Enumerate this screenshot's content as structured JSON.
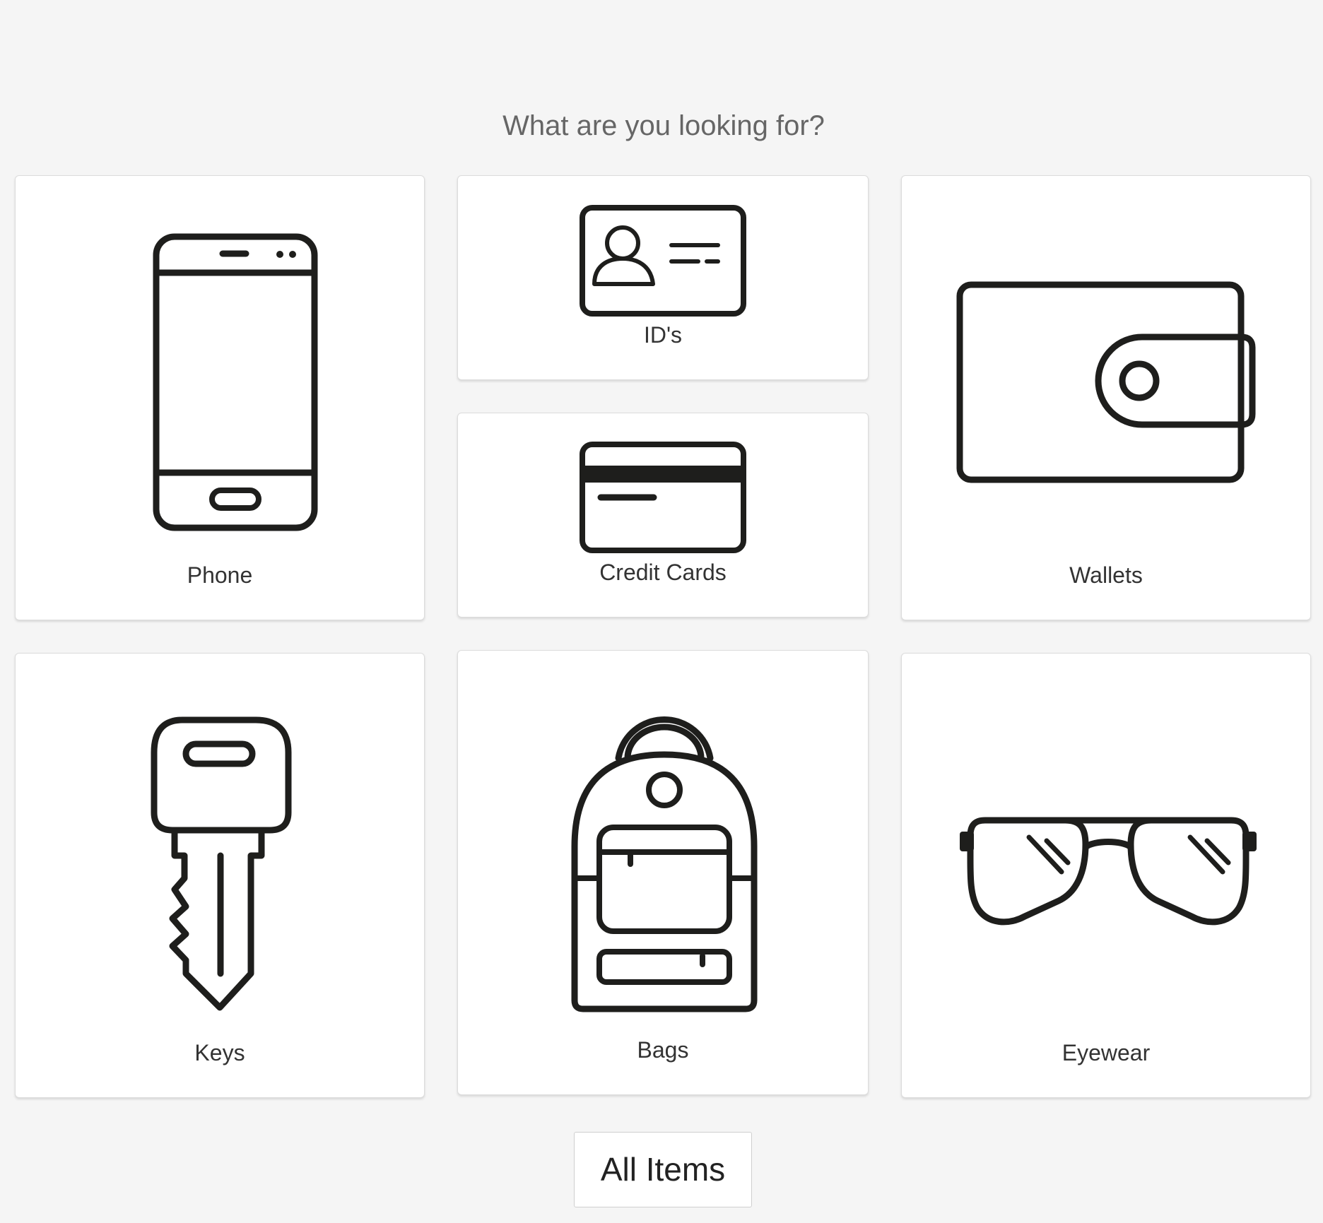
{
  "heading": "What are you looking for?",
  "categories": {
    "phone": {
      "label": "Phone",
      "icon": "phone-icon"
    },
    "ids": {
      "label": "ID's",
      "icon": "id-card-icon"
    },
    "credit_cards": {
      "label": "Credit Cards",
      "icon": "credit-card-icon"
    },
    "wallets": {
      "label": "Wallets",
      "icon": "wallet-icon"
    },
    "keys": {
      "label": "Keys",
      "icon": "key-icon"
    },
    "bags": {
      "label": "Bags",
      "icon": "backpack-icon"
    },
    "eyewear": {
      "label": "Eyewear",
      "icon": "glasses-icon"
    }
  },
  "all_items_button": "All Items",
  "colors": {
    "background": "#f5f5f5",
    "card": "#ffffff",
    "icon_stroke": "#1e1e1c",
    "heading_text": "#666666"
  }
}
